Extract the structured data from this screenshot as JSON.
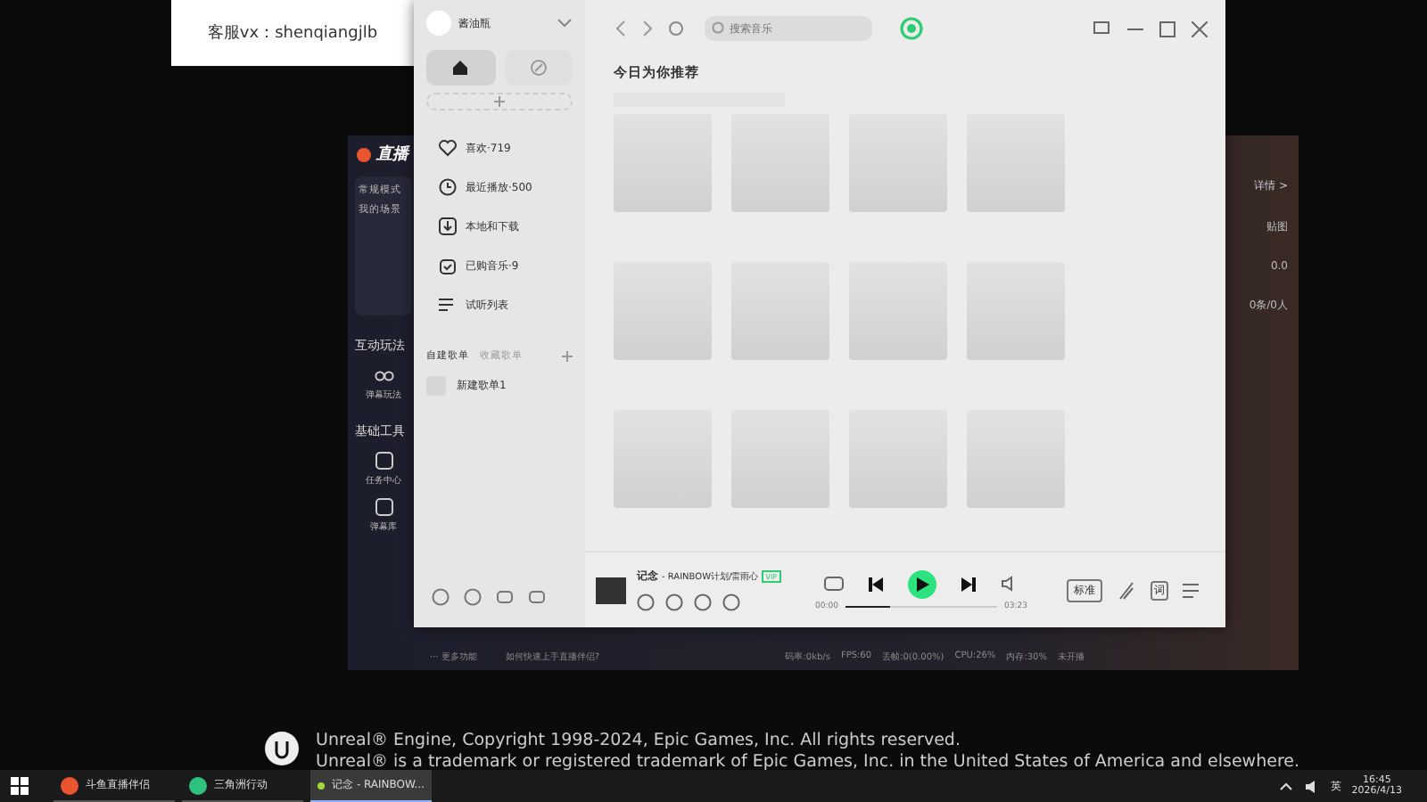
{
  "note": {
    "text": "客服vx：shenqiangjlb"
  },
  "stream_app": {
    "logo": "直播",
    "mode": "常规模式",
    "scenes_label": "我的场景",
    "sections": [
      {
        "title": "互动玩法",
        "tools": [
          {
            "label": "弹幕玩法"
          }
        ]
      },
      {
        "title": "基础工具",
        "tools": [
          {
            "label": "任务中心"
          },
          {
            "label": "弹幕库"
          }
        ]
      }
    ],
    "more": "··· 更多功能",
    "help": "如何快速上手直播伴侣?",
    "stats": [
      "码率:0kb/s",
      "FPS:60",
      "丢帧:0(0.00%)",
      "CPU:26%",
      "内存:30%",
      "未开播"
    ],
    "details": "详情 >",
    "paste": "贴图",
    "value": "0.0",
    "count": "0条/0人"
  },
  "music_app": {
    "user": "酱油瓶",
    "nav_tabs": [
      {
        "selected": true
      },
      {
        "selected": false
      }
    ],
    "nav_items": [
      {
        "label": "喜欢·719"
      },
      {
        "label": "最近播放·500"
      },
      {
        "label": "本地和下载"
      },
      {
        "label": "已购音乐·9"
      },
      {
        "label": "试听列表"
      }
    ],
    "playlist_tabs": [
      {
        "label": "自建歌单",
        "selected": true
      },
      {
        "label": "收藏歌单",
        "selected": false
      }
    ],
    "playlists": [
      {
        "label": "新建歌单1"
      }
    ],
    "search": {
      "placeholder": "搜索音乐"
    },
    "heading": "今日为你推荐",
    "player": {
      "title": "记念",
      "artist": "- RAINBOW计划/雷雨心",
      "badge": "VIP",
      "elapsed": "00:00",
      "duration": "03:23",
      "level": 0.3,
      "playing": false,
      "quality": "标准",
      "lyrics": "词"
    }
  },
  "engine_notice": [
    "Unreal® Engine, Copyright 1998-2024, Epic Games, Inc. All rights reserved.",
    "Unreal® is a trademark or registered trademark of Epic Games, Inc. in the United States of America and elsewhere."
  ],
  "taskbar": {
    "apps": [
      {
        "label": "斗鱼直播伴侣",
        "selected": false,
        "color": "#e8552f"
      },
      {
        "label": "三角洲行动",
        "selected": false,
        "color": "#2ec27e"
      },
      {
        "label": "记念 - RAINBOW...",
        "selected": true,
        "color": "#a5d63a"
      }
    ],
    "ime": "英",
    "time": "16:45",
    "date": "2026/4/13"
  }
}
